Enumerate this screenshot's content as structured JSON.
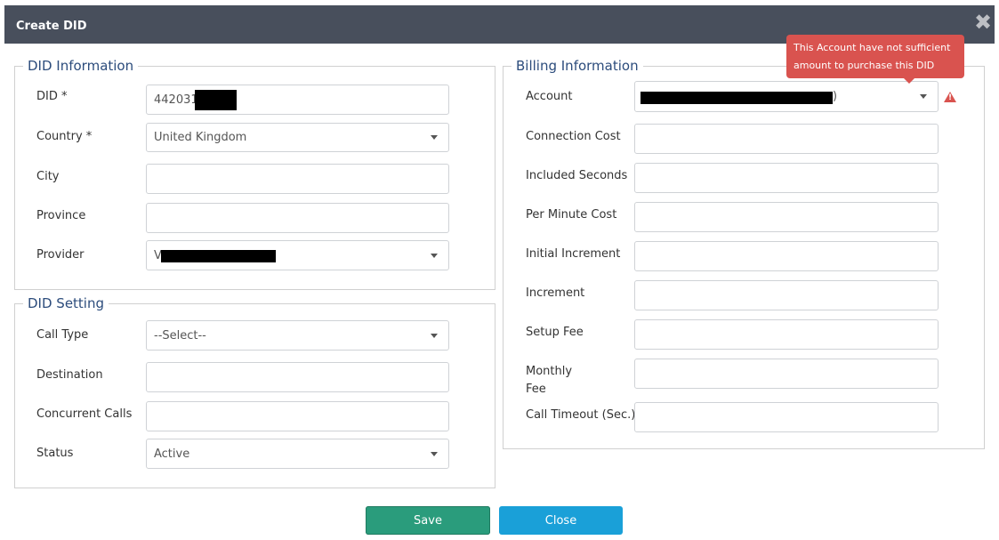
{
  "dialog": {
    "title": "Create DID",
    "close_glyph": "✖",
    "close_icon": "close-icon"
  },
  "did_information": {
    "legend": "DID Information",
    "did_label": "DID *",
    "did_value": "4420314",
    "country_label": "Country *",
    "country_value": "United Kingdom",
    "city_label": "City",
    "province_label": "Province",
    "provider_label": "Provider",
    "provider_value": "V"
  },
  "did_setting": {
    "legend": "DID Setting",
    "call_type_label": "Call Type",
    "call_type_value": "--Select--",
    "destination_label": "Destination",
    "concurrent_label": "Concurrent Calls",
    "status_label": "Status",
    "status_value": "Active"
  },
  "billing_information": {
    "legend": "Billing Information",
    "account_label": "Account",
    "account_value_suffix": ")",
    "connection_cost_label": "Connection Cost",
    "included_seconds_label": "Included Seconds",
    "per_minute_cost_label": "Per Minute Cost",
    "initial_increment_label": "Initial Increment",
    "increment_label": "Increment",
    "setup_fee_label": "Setup Fee",
    "monthly_label_line1": "Monthly",
    "monthly_label_line2": "Fee",
    "call_timeout_label": "Call Timeout (Sec.)"
  },
  "tooltip": {
    "line1": "This Account have not sufficient",
    "line2": "amount to purchase this DID",
    "color": "#d9534f"
  },
  "buttons": {
    "save": "Save",
    "close": "Close"
  },
  "colors": {
    "header_bg": "#484f5c",
    "legend_text": "#2c4c7c",
    "save_bg": "#2a9c7c",
    "close_bg": "#1aa0d8"
  }
}
